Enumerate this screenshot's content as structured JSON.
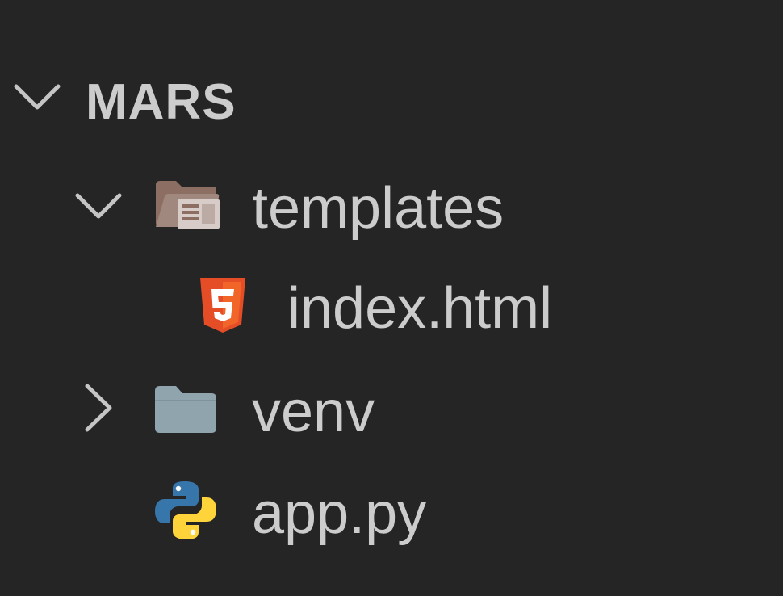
{
  "explorer": {
    "root": {
      "label": "MARS",
      "expanded": true
    },
    "items": [
      {
        "label": "templates",
        "kind": "folder",
        "expanded": true,
        "icon": "folder-open-templates-icon"
      },
      {
        "label": "index.html",
        "kind": "file",
        "icon": "html5-icon"
      },
      {
        "label": "venv",
        "kind": "folder",
        "expanded": false,
        "icon": "folder-closed-icon"
      },
      {
        "label": "app.py",
        "kind": "file",
        "icon": "python-icon"
      }
    ]
  },
  "colors": {
    "background": "#252526",
    "text": "#cccccc",
    "chevron": "#c5c5c5",
    "html5": "#e44d26",
    "folder_templates": "#8d6e63",
    "folder_venv": "#90a4ae",
    "python_blue": "#3776ab",
    "python_yellow": "#ffd43b"
  }
}
